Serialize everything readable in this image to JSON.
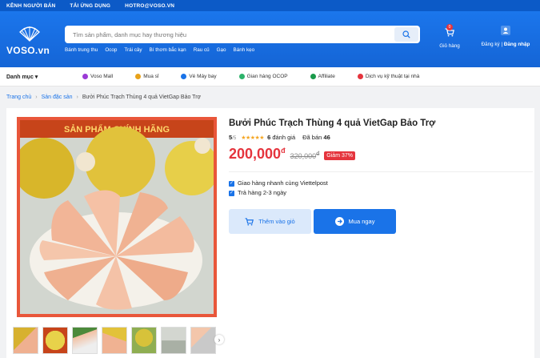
{
  "topbar": {
    "seller": "KÊNH NGƯỜI BÁN",
    "app": "TẢI ỨNG DỤNG",
    "email": "HOTRO@VOSO.VN"
  },
  "header": {
    "logo": "VOSO.vn",
    "search_placeholder": "Tìm sản phẩm, danh mục hay thương hiệu",
    "quick_links": [
      "Bánh trung thu",
      "Ocop",
      "Trái cây",
      "Bí thơm bắc kạn",
      "Rau củ",
      "Gạo",
      "Bánh kẹo"
    ],
    "cart_label": "Giỏ hàng",
    "cart_count": "0",
    "register": "Đăng ký",
    "login": "Đăng nhập"
  },
  "categories": {
    "menu_label": "Danh mục",
    "items": [
      {
        "label": "Voso Mall",
        "color": "#9b3bd6"
      },
      {
        "label": "Mua sỉ",
        "color": "#e8a21a"
      },
      {
        "label": "Vé Máy bay",
        "color": "#1a73e8"
      },
      {
        "label": "Gian hàng OCOP",
        "color": "#2db36a"
      },
      {
        "label": "Affiliate",
        "color": "#1a9a4a"
      },
      {
        "label": "Dịch vụ kỹ thuật tại nhà",
        "color": "#e5343d"
      }
    ]
  },
  "breadcrumb": {
    "home": "Trang chủ",
    "category": "Sản đặc sản",
    "current": "Bưởi Phúc Trạch Thùng 4 quả VietGap Bảo Trợ"
  },
  "product": {
    "banner_text": "SẢN PHẨM CHÍNH HÃNG",
    "title": "Bưởi Phúc Trạch Thùng 4 quả VietGap Bảo Trợ",
    "rating": "5",
    "rating_max": "/5",
    "review_count": "6",
    "review_label": "đánh giá",
    "sold_label": "Đã bán",
    "sold_count": "46",
    "price": "200,000",
    "currency": "đ",
    "old_price": "320,000",
    "discount": "Giảm 37%",
    "shipping": "Giao hàng nhanh cùng Viettelpost",
    "return_policy": "Trả hàng 2-3 ngày",
    "add_to_cart": "Thêm vào giỏ",
    "buy_now": "Mua ngay"
  },
  "colors": {
    "primary": "#1a73e8",
    "sale": "#e5343d",
    "star": "#f5a623"
  }
}
